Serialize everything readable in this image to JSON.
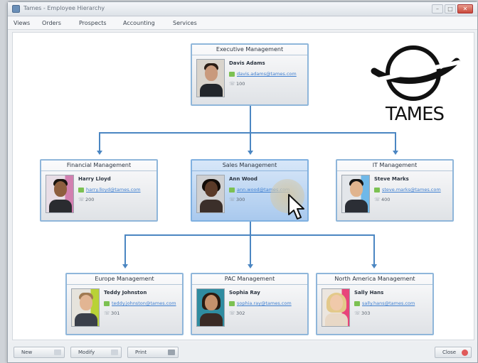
{
  "window": {
    "title": "Tames - Employee Hierarchy"
  },
  "menu": [
    "Views",
    "Orders",
    "Prospects",
    "Accounting",
    "Services"
  ],
  "logo": {
    "text": "TAMES"
  },
  "cards": {
    "executive": {
      "title": "Executive Management",
      "name": "Davis Adams",
      "email": "davis.adams@tames.com",
      "phone": "100"
    },
    "financial": {
      "title": "Financial Management",
      "name": "Harry Lloyd",
      "email": "harry.lloyd@tames.com",
      "phone": "200"
    },
    "sales": {
      "title": "Sales Management",
      "name": "Ann Wood",
      "email": "ann.wood@tames.com",
      "phone": "300"
    },
    "it": {
      "title": "IT Management",
      "name": "Steve Marks",
      "email": "steve.marks@tames.com",
      "phone": "400"
    },
    "europe": {
      "title": "Europe Management",
      "name": "Teddy Johnston",
      "email": "teddy.johnston@tames.com",
      "phone": "301"
    },
    "pac": {
      "title": "PAC Management",
      "name": "Sophia Ray",
      "email": "sophia.ray@tames.com",
      "phone": "302"
    },
    "north_america": {
      "title": "North America Management",
      "name": "Sally Hans",
      "email": "sally.hans@tames.com",
      "phone": "303"
    }
  },
  "buttons": {
    "new": "New",
    "modify": "Modify",
    "print": "Print",
    "close": "Close"
  },
  "colors": {
    "accent": "#4b86c2",
    "card_border": "#8fb6da",
    "selected": "#a9c9ee"
  }
}
